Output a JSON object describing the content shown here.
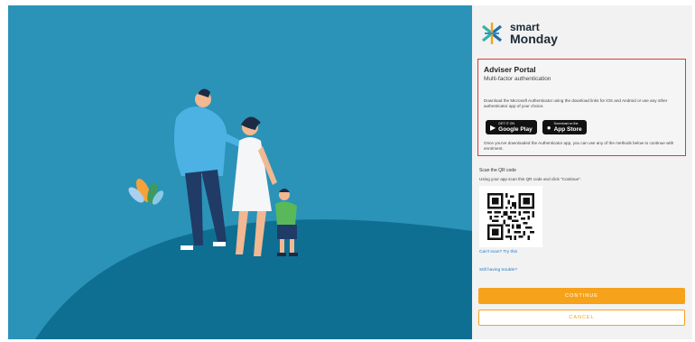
{
  "illustration": {
    "background": "#2b93b8",
    "hill": "#0f6f93"
  },
  "brand": {
    "name_line1": "smart",
    "name_line2": "Monday"
  },
  "adviser": {
    "title": "Adviser Portal",
    "subtitle": "Multi-factor authentication",
    "instructions": "Download the Microsoft Authenticator using the download links for iOS and Android or use any other authenticator app of your choice.",
    "google_play": {
      "small": "GET IT ON",
      "big": "Google Play"
    },
    "app_store": {
      "small": "Download on the",
      "big": "App Store"
    },
    "footer": "Once you've downloaded the Authenticator app, you can use any of the methods below to continue with enrolment."
  },
  "scan": {
    "title": "Scan the QR code",
    "text": "Using your app scan this QR code and click \"Continue\"."
  },
  "links": {
    "cant_scan": "Can't scan? Try this",
    "trouble": "Still having trouble?"
  },
  "actions": {
    "continue": "CONTINUE",
    "cancel": "CANCEL"
  },
  "colors": {
    "accent": "#f7a21b",
    "highlight_border": "#d63b3b",
    "link": "#1f78c1"
  }
}
